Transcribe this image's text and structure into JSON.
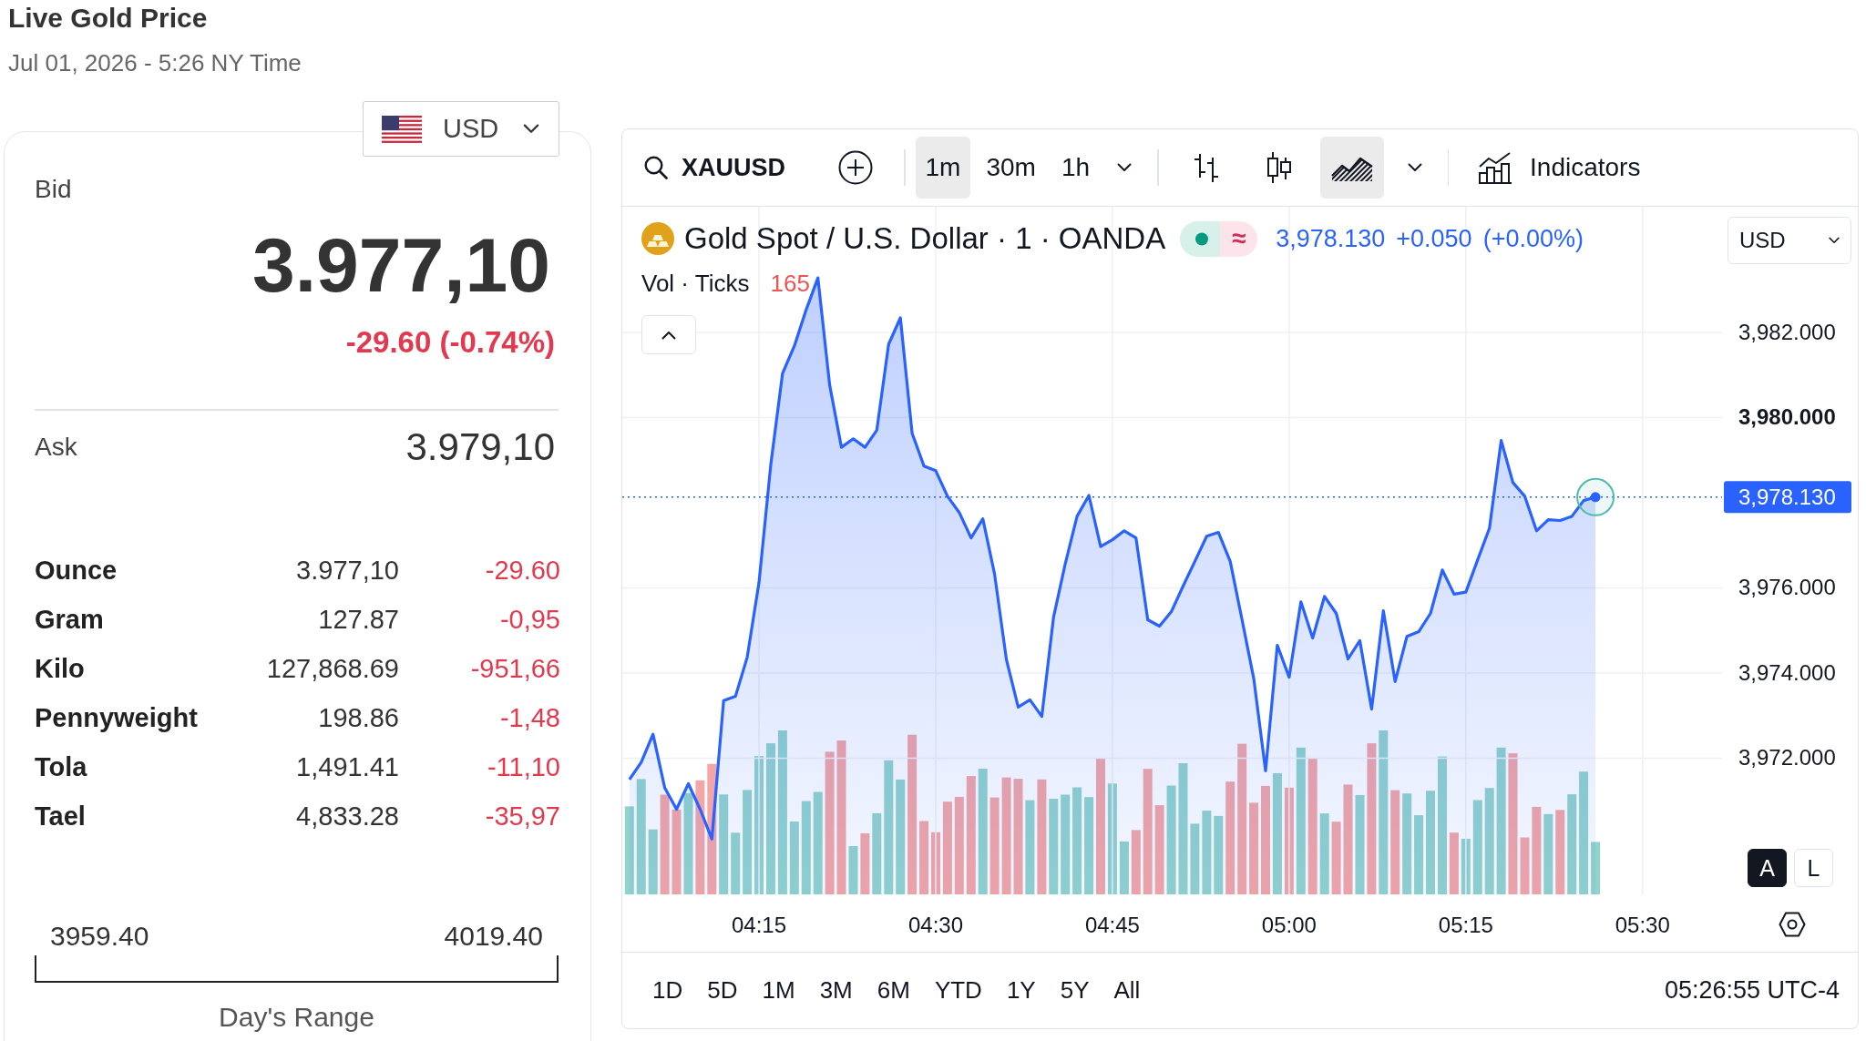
{
  "header": {
    "title": "Live Gold Price",
    "datetime": "Jul 01, 2026 - 5:26 NY Time"
  },
  "currency_select": {
    "value": "USD"
  },
  "quote": {
    "bid_label": "Bid",
    "bid": "3.977,10",
    "change": "-29.60 (-0.74%)",
    "down": true,
    "ask_label": "Ask",
    "ask": "3.979,10"
  },
  "units": [
    {
      "name": "Ounce",
      "price": "3.977,10",
      "change": "-29.60",
      "down": true
    },
    {
      "name": "Gram",
      "price": "127.87",
      "change": "-0,95",
      "down": true
    },
    {
      "name": "Kilo",
      "price": "127,868.69",
      "change": "-951,66",
      "down": true
    },
    {
      "name": "Pennyweight",
      "price": "198.86",
      "change": "-1,48",
      "down": true
    },
    {
      "name": "Tola",
      "price": "1,491.41",
      "change": "-11,10",
      "down": true
    },
    {
      "name": "Tael",
      "price": "4,833.28",
      "change": "-35,97",
      "down": true
    }
  ],
  "day_range": {
    "low": "3959.40",
    "high": "4019.40",
    "label": "Day's Range"
  },
  "chart": {
    "toolbar": {
      "symbol": "XAUUSD",
      "intervals": [
        {
          "label": "1m",
          "selected": true
        },
        {
          "label": "30m",
          "selected": false
        },
        {
          "label": "1h",
          "selected": false
        }
      ],
      "styles": [
        {
          "kind": "bars",
          "selected": false
        },
        {
          "kind": "candles",
          "selected": false
        },
        {
          "kind": "area",
          "selected": true
        }
      ],
      "indicators_label": "Indicators"
    },
    "legend": {
      "title": "Gold Spot / U.S. Dollar · 1 · OANDA",
      "status_mark": "≈",
      "price": "3,978.130",
      "change": "+0.050",
      "change_percent": "(+0.00%)"
    },
    "volume_legend": {
      "title": "Vol · Ticks",
      "value": "165",
      "down": true
    },
    "currency": "USD",
    "scale_modes": [
      {
        "label": "A",
        "selected": true
      },
      {
        "label": "L",
        "selected": false
      }
    ],
    "chart_data": {
      "type": "area",
      "categories": [
        null,
        null,
        null,
        null,
        null,
        null,
        null,
        null,
        null,
        null,
        null,
        "04:15",
        null,
        null,
        null,
        null,
        null,
        null,
        null,
        null,
        null,
        null,
        null,
        null,
        null,
        null,
        "04:30",
        null,
        null,
        null,
        null,
        null,
        null,
        null,
        null,
        null,
        null,
        null,
        null,
        null,
        null,
        "04:45",
        null,
        null,
        null,
        null,
        null,
        null,
        null,
        null,
        null,
        null,
        null,
        null,
        null,
        null,
        "05:00",
        null,
        null,
        null,
        null,
        null,
        null,
        null,
        null,
        null,
        null,
        null,
        null,
        null,
        null,
        "05:15",
        null,
        null,
        null,
        null,
        null,
        null,
        null,
        null,
        null,
        null,
        null,
        null,
        null,
        null,
        "05:30"
      ],
      "series": [
        {
          "color": "#2962ff",
          "values": [
            3971.5,
            3971.9,
            3972.56,
            3971.3,
            3970.8,
            3971.4,
            3970.8,
            3970.1,
            3973.35,
            3973.45,
            3974.37,
            3976.12,
            3978.9,
            3981.04,
            3981.68,
            3982.53,
            3983.28,
            3980.76,
            3979.3,
            3979.5,
            3979.3,
            3979.7,
            3981.72,
            3982.34,
            3979.63,
            3978.86,
            3978.75,
            3978.15,
            3977.77,
            3977.17,
            3977.62,
            3976.32,
            3974.31,
            3973.2,
            3973.37,
            3972.98,
            3975.31,
            3976.57,
            3977.68,
            3978.17,
            3976.97,
            3977.13,
            3977.34,
            3977.17,
            3975.25,
            3975.1,
            3975.44,
            3976.04,
            3976.62,
            3977.21,
            3977.3,
            3976.62,
            3975.25,
            3973.86,
            3971.7,
            3974.65,
            3973.9,
            3975.67,
            3974.82,
            3975.8,
            3975.4,
            3974.33,
            3974.76,
            3973.15,
            3975.46,
            3973.8,
            3974.86,
            3974.97,
            3975.4,
            3976.42,
            3975.85,
            3975.9,
            3976.66,
            3977.4,
            3979.46,
            3978.47,
            3978.15,
            3977.34,
            3977.6,
            3977.58,
            3977.68,
            3978.05,
            3978.13,
            null,
            null,
            null,
            null
          ]
        }
      ],
      "ylim": [
        3968.8,
        3984.95
      ],
      "yticks": [
        {
          "value": 3982,
          "label": "3,982.000"
        },
        {
          "value": 3980,
          "label": "3,980.000"
        },
        {
          "value": 3976,
          "label": "3,976.000"
        },
        {
          "value": 3974,
          "label": "3,974.000"
        },
        {
          "value": 3972,
          "label": "3,972.000"
        }
      ],
      "grid": true,
      "ref_lines": [
        {
          "axis": "y",
          "value": 3978.13,
          "label": "3,978.130"
        }
      ]
    },
    "ranges": [
      "1D",
      "5D",
      "1M",
      "3M",
      "6M",
      "YTD",
      "1Y",
      "5Y",
      "All"
    ],
    "clock": "05:26:55 UTC-4"
  }
}
